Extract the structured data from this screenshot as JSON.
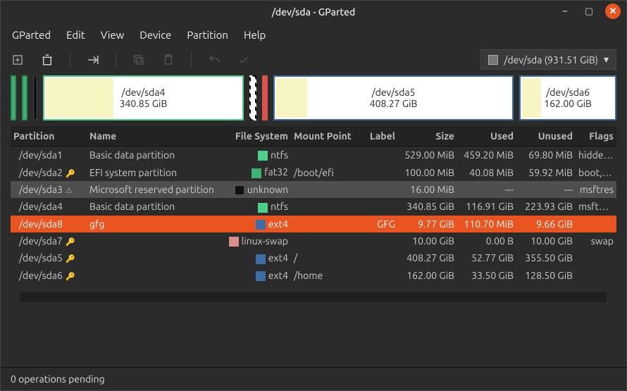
{
  "title": "/dev/sda - GParted",
  "menu": [
    "GParted",
    "Edit",
    "View",
    "Device",
    "Partition",
    "Help"
  ],
  "device_selector": "/dev/sda  (931.51 GiB)",
  "map": [
    {
      "label": "/dev/sda4",
      "sub": "340.85 GiB"
    },
    {
      "label": "/dev/sda5",
      "sub": "408.27 GiB"
    },
    {
      "label": "/dev/sda6",
      "sub": "162.00 GiB"
    }
  ],
  "headers": {
    "partition": "Partition",
    "name": "Name",
    "fs": "File System",
    "mount": "Mount Point",
    "label": "Label",
    "size": "Size",
    "used": "Used",
    "unused": "Unused",
    "flags": "Flags"
  },
  "rows": [
    {
      "part": "/dev/sda1",
      "name": "Basic data partition",
      "fs": "ntfs",
      "fsClass": "c-ntfs",
      "mount": "",
      "label": "",
      "size": "529.00 MiB",
      "used": "459.20 MiB",
      "unused": "69.80 MiB",
      "flags": "hidden, di",
      "icon": ""
    },
    {
      "part": "/dev/sda2",
      "name": "EFI system partition",
      "fs": "fat32",
      "fsClass": "c-fat32",
      "mount": "/boot/efi",
      "label": "",
      "size": "100.00 MiB",
      "used": "40.08 MiB",
      "unused": "59.92 MiB",
      "flags": "boot, esp",
      "icon": "key"
    },
    {
      "part": "/dev/sda3",
      "name": "Microsoft reserved partition",
      "fs": "unknown",
      "fsClass": "c-unk",
      "mount": "",
      "label": "",
      "size": "16.00 MiB",
      "used": "---",
      "unused": "---",
      "flags": "msftres",
      "icon": "warn",
      "state": "active"
    },
    {
      "part": "/dev/sda4",
      "name": "Basic data partition",
      "fs": "ntfs",
      "fsClass": "c-ntfs",
      "mount": "",
      "label": "",
      "size": "340.85 GiB",
      "used": "116.91 GiB",
      "unused": "223.93 GiB",
      "flags": "msftdata",
      "icon": ""
    },
    {
      "part": "/dev/sda8",
      "name": "gfg",
      "fs": "ext4",
      "fsClass": "c-ext4",
      "mount": "",
      "label": "GFG",
      "size": "9.77 GiB",
      "used": "110.70 MiB",
      "unused": "9.66 GiB",
      "flags": "",
      "icon": "",
      "state": "sel"
    },
    {
      "part": "/dev/sda7",
      "name": "",
      "fs": "linux-swap",
      "fsClass": "c-swap",
      "mount": "",
      "label": "",
      "size": "10.00 GiB",
      "used": "0.00 B",
      "unused": "10.00 GiB",
      "flags": "swap",
      "icon": "key"
    },
    {
      "part": "/dev/sda5",
      "name": "",
      "fs": "ext4",
      "fsClass": "c-ext4",
      "mount": "/",
      "label": "",
      "size": "408.27 GiB",
      "used": "52.77 GiB",
      "unused": "355.50 GiB",
      "flags": "",
      "icon": "key"
    },
    {
      "part": "/dev/sda6",
      "name": "",
      "fs": "ext4",
      "fsClass": "c-ext4",
      "mount": "/home",
      "label": "",
      "size": "162.00 GiB",
      "used": "33.50 GiB",
      "unused": "128.50 GiB",
      "flags": "",
      "icon": "key"
    }
  ],
  "status": "0 operations pending"
}
